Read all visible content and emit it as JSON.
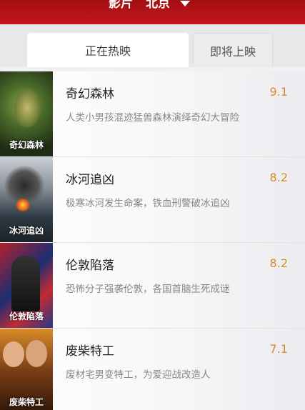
{
  "header": {
    "section": "影片",
    "city": "北京"
  },
  "tabs": [
    {
      "label": "正在热映",
      "active": true
    },
    {
      "label": "即将上映",
      "active": false
    }
  ],
  "movies": [
    {
      "title": "奇幻森林",
      "score": "9.1",
      "desc": "人类小男孩混迹猛兽森林演绎奇幻大冒险",
      "poster_text": "奇幻森林"
    },
    {
      "title": "冰河追凶",
      "score": "8.2",
      "desc": "极寒冰河发生命案，铁血刑警破冰追凶",
      "poster_text": "冰河追凶"
    },
    {
      "title": "伦敦陷落",
      "score": "8.2",
      "desc": "恐怖分子强袭伦敦，各国首脑生死成谜",
      "poster_text": "伦敦陷落"
    },
    {
      "title": "废柴特工",
      "score": "7.1",
      "desc": "废材宅男变特工，为爱迎战改造人",
      "poster_text": "废柴特工"
    }
  ],
  "colors": {
    "header": "#b81418",
    "score": "#d88b28"
  }
}
